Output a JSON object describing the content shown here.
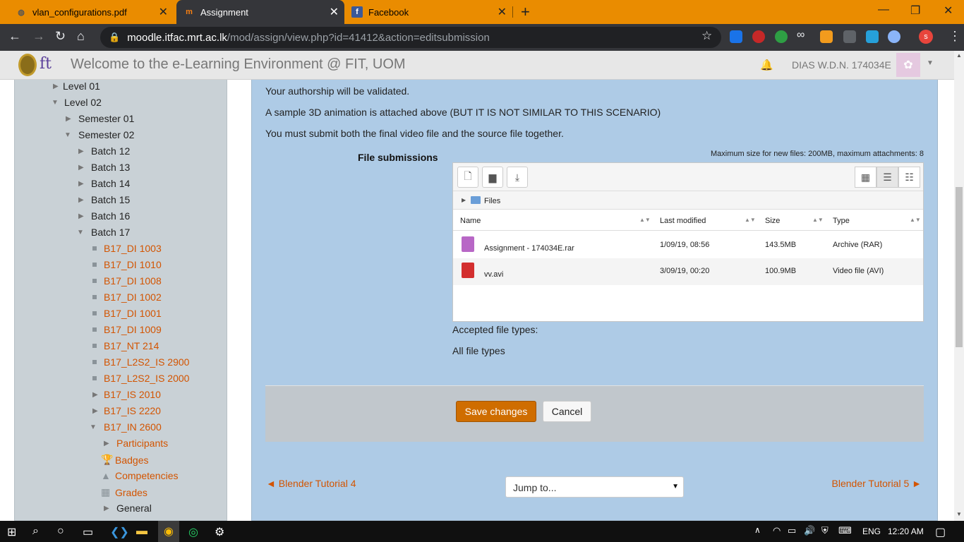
{
  "browser": {
    "tabs": [
      {
        "title": "vlan_configurations.pdf",
        "icon": "pdf-tab-icon"
      },
      {
        "title": "Assignment",
        "icon": "moodle-tab-icon",
        "active": true
      },
      {
        "title": "Facebook",
        "icon": "facebook-tab-icon"
      }
    ],
    "new_tab": "+",
    "url_host": "moodle.itfac.mrt.ac.lk",
    "url_path": "/mod/assign/view.php?id=41412&action=editsubmission",
    "profile_initial": "s"
  },
  "header": {
    "site_name": "Welcome to the e-Learning Environment @ FIT, UOM",
    "logo_text": "ft",
    "username": "DIAS W.D.N. 174034E"
  },
  "sidebar": {
    "items": [
      {
        "label": "Level 01"
      },
      {
        "label": "Level 02"
      },
      {
        "label": "Semester 01"
      },
      {
        "label": "Semester 02"
      },
      {
        "label": "Batch 12"
      },
      {
        "label": "Batch 13"
      },
      {
        "label": "Batch 14"
      },
      {
        "label": "Batch 15"
      },
      {
        "label": "Batch 16"
      },
      {
        "label": "Batch 17"
      },
      {
        "label": "B17_DI 1003"
      },
      {
        "label": "B17_DI 1010"
      },
      {
        "label": "B17_DI 1008"
      },
      {
        "label": "B17_DI 1002"
      },
      {
        "label": "B17_DI 1001"
      },
      {
        "label": "B17_DI 1009"
      },
      {
        "label": "B17_NT 214"
      },
      {
        "label": "B17_L2S2_IS 2900"
      },
      {
        "label": "B17_L2S2_IS 2000"
      },
      {
        "label": "B17_IS 2010"
      },
      {
        "label": "B17_IS 2220"
      },
      {
        "label": "B17_IN 2600"
      },
      {
        "label": "Participants"
      },
      {
        "label": "Badges"
      },
      {
        "label": "Competencies"
      },
      {
        "label": "Grades"
      },
      {
        "label": "General"
      }
    ]
  },
  "main": {
    "paragraphs": [
      "Your authorship will be validated.",
      "A sample 3D animation is attached above (BUT IT IS NOT SIMILAR TO THIS SCENARIO)",
      "You must submit both the final video file and the source file together."
    ],
    "file_submissions_label": "File submissions",
    "max_size_note": "Maximum size for new files: 200MB, maximum attachments: 8",
    "path_label": "Files",
    "columns": [
      "Name",
      "Last modified",
      "Size",
      "Type"
    ],
    "files": [
      {
        "name": "Assignment - 174034E.rar",
        "modified": "1/09/19, 08:56",
        "size": "143.5MB",
        "type": "Archive (RAR)"
      },
      {
        "name": "vv.avi",
        "modified": "3/09/19, 00:20",
        "size": "100.9MB",
        "type": "Video file (AVI)"
      }
    ],
    "accepted_label": "Accepted file types:",
    "accepted_value": "All file types",
    "save_label": "Save changes",
    "cancel_label": "Cancel",
    "prev_link": "◄ Blender Tutorial 4",
    "next_link": "Blender Tutorial 5 ►",
    "jump_to": "Jump to..."
  },
  "taskbar": {
    "language": "ENG",
    "time": "12:20 AM"
  },
  "colors": {
    "tab_bar": "#ea8c00",
    "link": "#d35400",
    "save_button": "#cf6d00",
    "main_bg": "#aecbe6",
    "sidebar_bg": "#c9d1d6"
  }
}
